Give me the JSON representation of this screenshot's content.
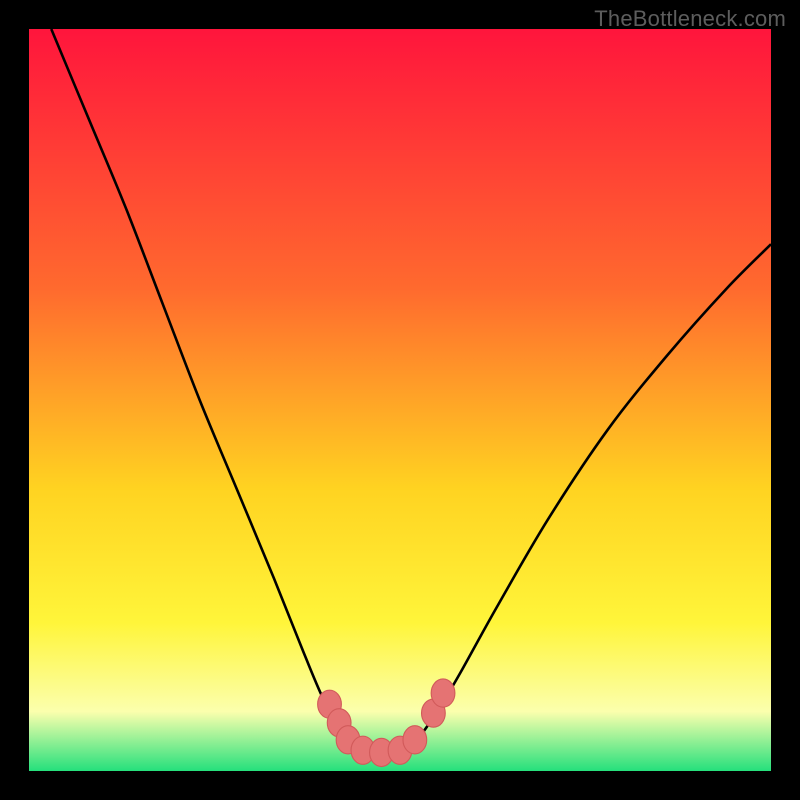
{
  "watermark": {
    "text": "TheBottleneck.com"
  },
  "colors": {
    "gradient_top": "#ff153c",
    "gradient_mid_upper": "#ff6a2e",
    "gradient_mid": "#ffd321",
    "gradient_lower": "#fff53a",
    "gradient_pale": "#fbffad",
    "gradient_bottom": "#25e07c",
    "curve": "#000000",
    "marker_fill": "#e57373",
    "marker_stroke": "#d15a5a"
  },
  "chart_data": {
    "type": "line",
    "title": "",
    "xlabel": "",
    "ylabel": "",
    "xlim": [
      0,
      100
    ],
    "ylim": [
      0,
      100
    ],
    "note": "Values are read in percent of plot width/height; y=0 is bottom, y=100 is top. Curve is a bottleneck V-shape with flat minimum near x≈43–52.",
    "series": [
      {
        "name": "bottleneck-curve",
        "x": [
          3,
          8,
          13,
          18,
          23,
          28,
          33,
          37,
          40,
          43,
          46,
          49,
          52,
          55,
          58,
          63,
          70,
          78,
          86,
          94,
          100
        ],
        "y": [
          100,
          88,
          76,
          63,
          50,
          38,
          26,
          16,
          9,
          4,
          2.5,
          2.5,
          4,
          8,
          13,
          22,
          34,
          46,
          56,
          65,
          71
        ]
      }
    ],
    "markers": {
      "name": "salmon-dots",
      "points": [
        {
          "x": 40.5,
          "y": 9.0
        },
        {
          "x": 41.8,
          "y": 6.5
        },
        {
          "x": 43.0,
          "y": 4.2
        },
        {
          "x": 45.0,
          "y": 2.8
        },
        {
          "x": 47.5,
          "y": 2.5
        },
        {
          "x": 50.0,
          "y": 2.8
        },
        {
          "x": 52.0,
          "y": 4.2
        },
        {
          "x": 54.5,
          "y": 7.8
        },
        {
          "x": 55.8,
          "y": 10.5
        }
      ],
      "rx": 1.6,
      "ry": 1.9
    }
  }
}
